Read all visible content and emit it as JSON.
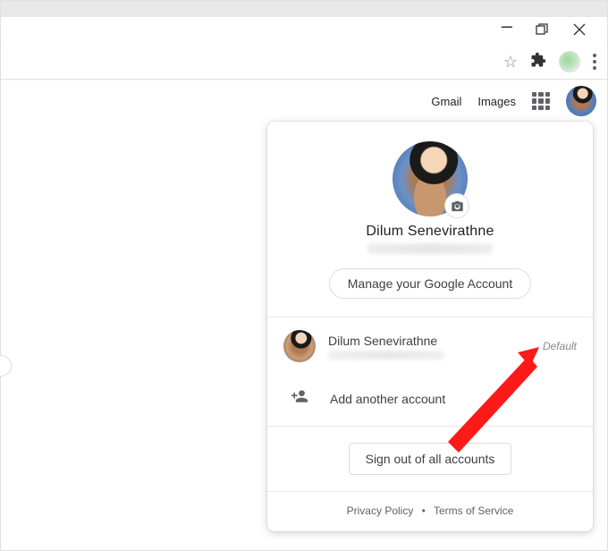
{
  "header": {
    "gmail": "Gmail",
    "images": "Images"
  },
  "card": {
    "display_name": "Dilum Senevirathne",
    "manage_btn": "Manage your Google Account",
    "accounts": [
      {
        "name": "Dilum Senevirathne",
        "tag": "Default"
      }
    ],
    "add_account": "Add another account",
    "sign_out": "Sign out of all accounts",
    "privacy": "Privacy Policy",
    "terms": "Terms of Service"
  }
}
